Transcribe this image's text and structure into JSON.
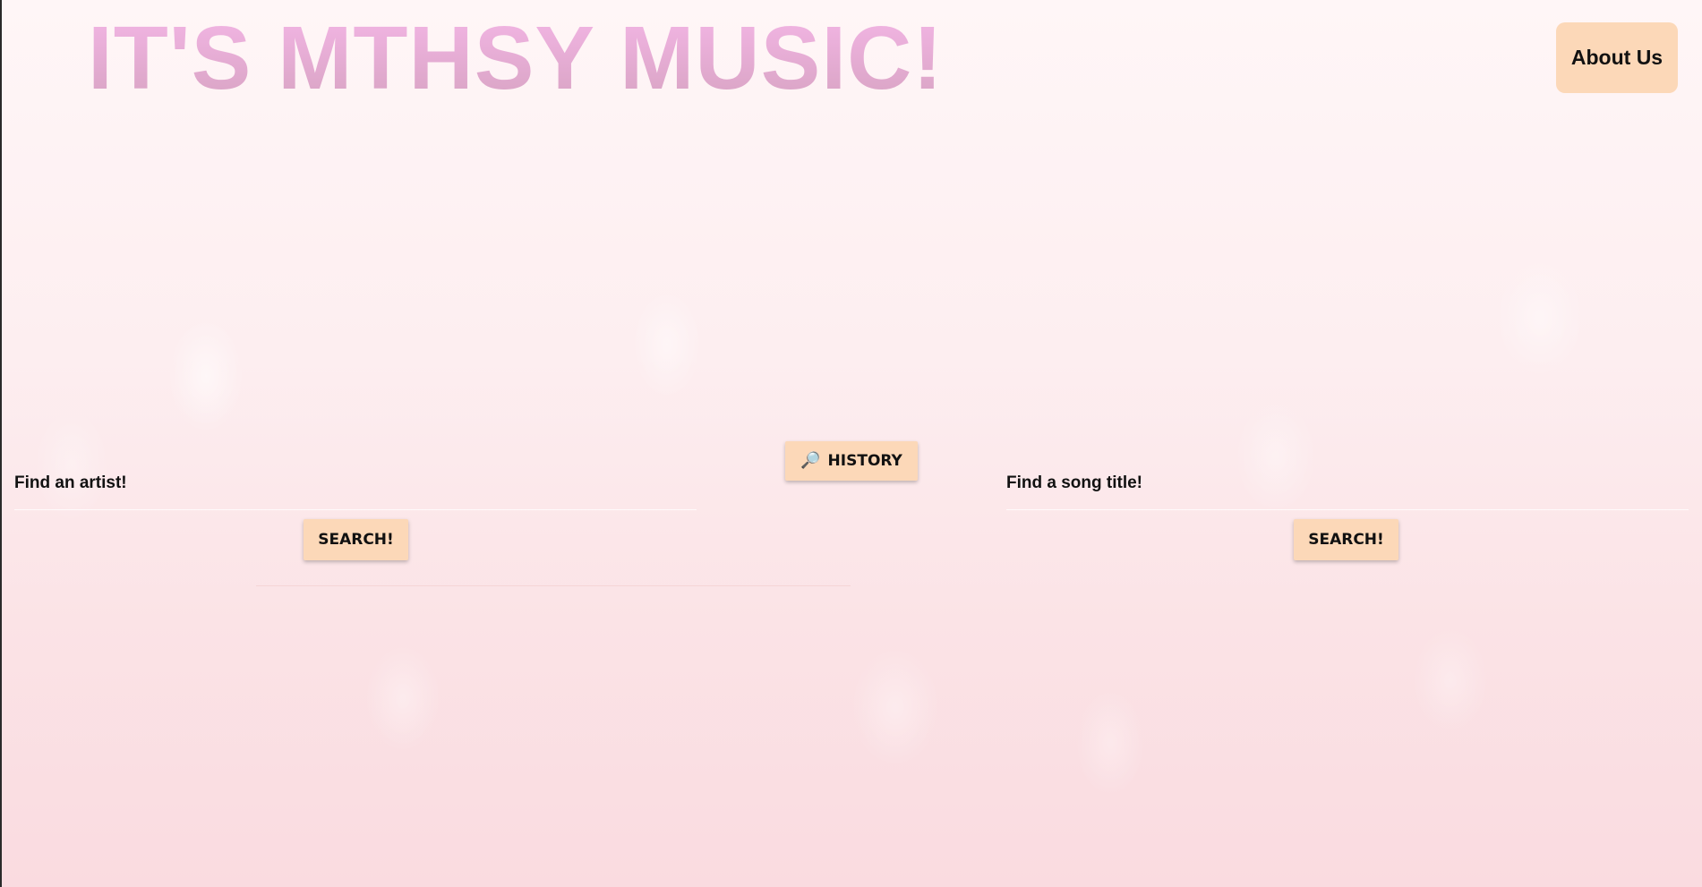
{
  "header": {
    "title": "IT'S MTHSY MUSIC!",
    "about_label": "About Us"
  },
  "history": {
    "icon": "magnifier-icon",
    "label": "HISTORY"
  },
  "artist_search": {
    "label": "Find an artist!",
    "value": "",
    "button_label": "SEARCH!"
  },
  "song_search": {
    "label": "Find a song title!",
    "value": "",
    "button_label": "SEARCH!"
  },
  "colors": {
    "button_bg": "#fcd8b8",
    "title_pink": "#f4b6e6",
    "background": "#fdeef0"
  }
}
